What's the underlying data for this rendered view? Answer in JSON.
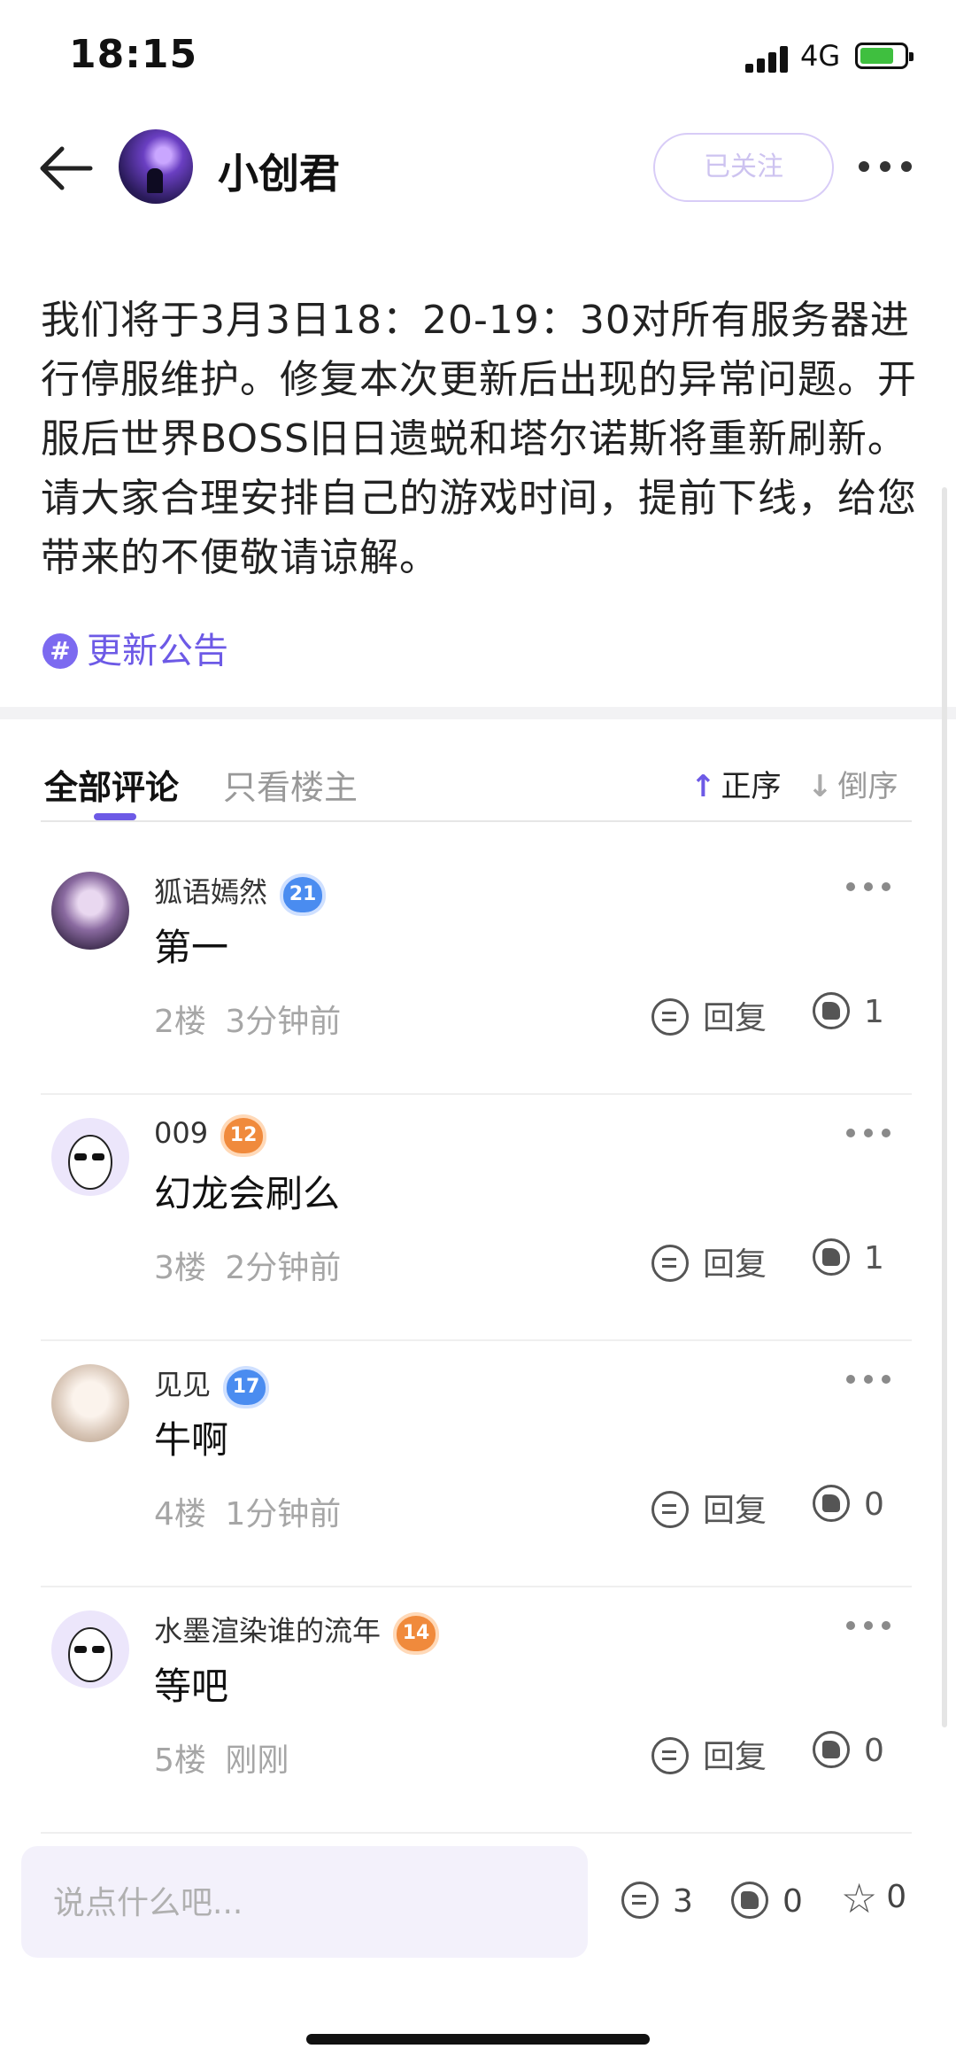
{
  "status_bar": {
    "time": "18:15",
    "network": "4G"
  },
  "header": {
    "username": "小创君",
    "follow_label": "已关注"
  },
  "post": {
    "text": "我们将于3月3日18：20-19：30对所有服务器进行停服维护。修复本次更新后出现的异常问题。开服后世界BOSS旧日遗蜕和塔尔诺斯将重新刷新。请大家合理安排自己的游戏时间，提前下线，给您带来的不便敬请谅解。",
    "tag": "更新公告"
  },
  "tabs": {
    "all": "全部评论",
    "owner_only": "只看楼主",
    "asc": "正序",
    "desc": "倒序"
  },
  "comments": [
    {
      "name": "狐语嫣然",
      "level": "21",
      "level_color": "#4a8cf0",
      "text": "第一",
      "floor": "2楼",
      "time": "3分钟前",
      "reply": "回复",
      "likes": "1"
    },
    {
      "name": "009",
      "level": "12",
      "level_color": "#f08a3c",
      "text": "幻龙会刷么",
      "floor": "3楼",
      "time": "2分钟前",
      "reply": "回复",
      "likes": "1"
    },
    {
      "name": "见见",
      "level": "17",
      "level_color": "#4a8cf0",
      "text": "牛啊",
      "floor": "4楼",
      "time": "1分钟前",
      "reply": "回复",
      "likes": "0"
    },
    {
      "name": "水墨渲染谁的流年",
      "level": "14",
      "level_color": "#f08a3c",
      "text": "等吧",
      "floor": "5楼",
      "time": "刚刚",
      "reply": "回复",
      "likes": "0"
    }
  ],
  "bottom_bar": {
    "placeholder": "说点什么吧...",
    "comments": "3",
    "likes": "0",
    "stars": "0"
  },
  "colors": {
    "accent": "#6d5ae6"
  }
}
